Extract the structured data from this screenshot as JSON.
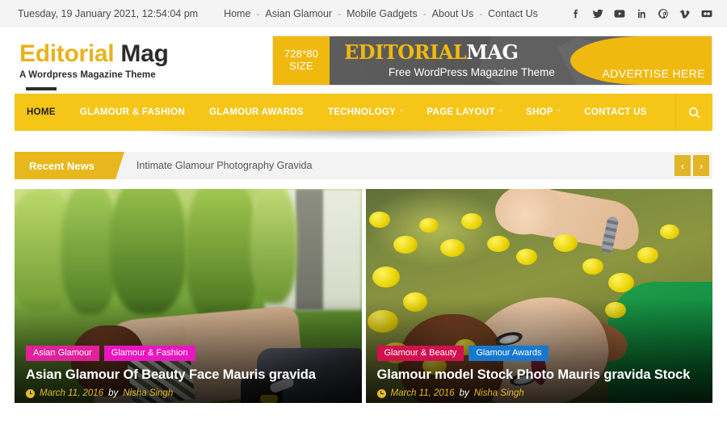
{
  "topbar": {
    "datetime": "Tuesday, 19 January 2021, 12:54:04 pm",
    "links": [
      "Home",
      "Asian Glamour",
      "Mobile Gadgets",
      "About Us",
      "Contact Us"
    ],
    "separator": "-",
    "social": [
      {
        "name": "facebook-icon",
        "label": "Facebook"
      },
      {
        "name": "twitter-icon",
        "label": "Twitter"
      },
      {
        "name": "youtube-icon",
        "label": "YouTube"
      },
      {
        "name": "linkedin-icon",
        "label": "LinkedIn"
      },
      {
        "name": "pinterest-icon",
        "label": "Pinterest"
      },
      {
        "name": "vimeo-icon",
        "label": "Vimeo"
      },
      {
        "name": "flickr-icon",
        "label": "Flickr"
      }
    ]
  },
  "header": {
    "logo_part1": "Editorial",
    "logo_part2": "Mag",
    "tagline": "A Wordpress Magazine Theme",
    "ad": {
      "size_line1": "728*80",
      "size_line2": "SIZE",
      "title_part1": "EDITORIAL",
      "title_part2": "MAG",
      "subtitle": "Free WordPress Magazine Theme",
      "cta": "ADVERTISE HERE"
    }
  },
  "nav": {
    "items": [
      {
        "label": "HOME",
        "active": true,
        "has_dropdown": false
      },
      {
        "label": "GLAMOUR & FASHION",
        "active": false,
        "has_dropdown": false
      },
      {
        "label": "GLAMOUR AWARDS",
        "active": false,
        "has_dropdown": false
      },
      {
        "label": "TECHNOLOGY",
        "active": false,
        "has_dropdown": true
      },
      {
        "label": "PAGE LAYOUT",
        "active": false,
        "has_dropdown": true
      },
      {
        "label": "SHOP",
        "active": false,
        "has_dropdown": true
      },
      {
        "label": "CONTACT US",
        "active": false,
        "has_dropdown": false
      }
    ],
    "caret": "ˇ",
    "search_icon": "search-icon"
  },
  "recent_news": {
    "tag": "Recent News",
    "headline": "Intimate Glamour Photography Gravida",
    "prev": "‹",
    "next": "›"
  },
  "featured": [
    {
      "badges": [
        {
          "label": "Asian Glamour",
          "color": "#e0219b"
        },
        {
          "label": "Glamour & Fashion",
          "color": "#e916bf"
        }
      ],
      "title": "Asian Glamour Of Beauty Face Mauris gravida",
      "date": "March 11, 2016",
      "by_label": "by",
      "author": "Nisha Singh"
    },
    {
      "badges": [
        {
          "label": "Glamour & Beauty",
          "color": "#d2104e"
        },
        {
          "label": "Glamour Awards",
          "color": "#1878cf"
        }
      ],
      "title": "Glamour model Stock Photo Mauris gravida Stock",
      "date": "March 11, 2016",
      "by_label": "by",
      "author": "Nisha Singh"
    }
  ],
  "colors": {
    "brand_yellow": "#f5c518",
    "accent_gold": "#e8b71d",
    "topbar_bg": "#f4f4f4",
    "text_dark": "#2c2c2c"
  }
}
